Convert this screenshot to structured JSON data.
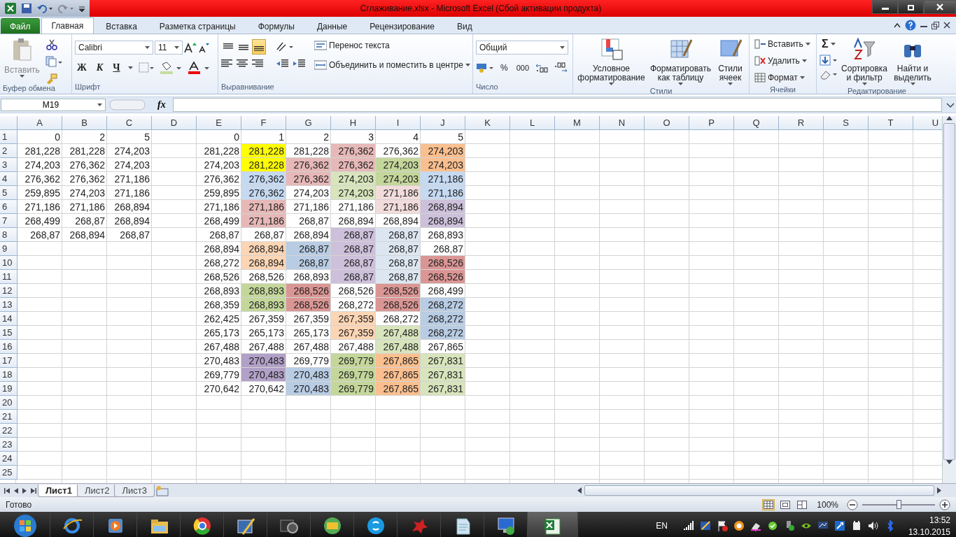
{
  "window": {
    "title": "Сглаживание.xlsx  -  Microsoft Excel (Сбой активации продукта)"
  },
  "tabs": [
    {
      "label": "Файл",
      "kind": "file",
      "selected": false
    },
    {
      "label": "Главная",
      "kind": "tab",
      "selected": true
    },
    {
      "label": "Вставка",
      "kind": "tab",
      "selected": false
    },
    {
      "label": "Разметка страницы",
      "kind": "tab",
      "selected": false
    },
    {
      "label": "Формулы",
      "kind": "tab",
      "selected": false
    },
    {
      "label": "Данные",
      "kind": "tab",
      "selected": false
    },
    {
      "label": "Рецензирование",
      "kind": "tab",
      "selected": false
    },
    {
      "label": "Вид",
      "kind": "tab",
      "selected": false
    }
  ],
  "ribbon": {
    "clipboard": {
      "label": "Буфер обмена",
      "paste": "Вставить"
    },
    "font": {
      "label": "Шрифт",
      "family": "Calibri",
      "size": "11",
      "bold": "Ж",
      "italic": "К",
      "underline": "Ч"
    },
    "alignment": {
      "label": "Выравнивание",
      "wrap": "Перенос текста",
      "merge": "Объединить и поместить в центре",
      "vertical": [
        {
          "selected": false
        },
        {
          "selected": false
        },
        {
          "selected": true
        }
      ]
    },
    "number": {
      "label": "Число",
      "format": "Общий",
      "percent": "%",
      "thousands": "000"
    },
    "styles": {
      "label": "Стили",
      "buttons": [
        "Условное форматирование",
        "Форматировать как таблицу",
        "Стили ячеек"
      ]
    },
    "cells": {
      "label": "Ячейки",
      "buttons": [
        "Вставить",
        "Удалить",
        "Формат"
      ]
    },
    "editing": {
      "label": "Редактирование",
      "sum": "Σ",
      "buttons": [
        "Сортировка и фильтр",
        "Найти и выделить"
      ]
    }
  },
  "formula_bar": {
    "name_box": "M19",
    "fx": "fx"
  },
  "sheet": {
    "columns": [
      "A",
      "B",
      "C",
      "D",
      "E",
      "F",
      "G",
      "H",
      "I",
      "J",
      "K",
      "L",
      "M",
      "N",
      "O",
      "P",
      "Q",
      "R",
      "S",
      "T",
      "U"
    ],
    "rows": [
      {
        "number": "1",
        "cells": [
          "0",
          "2",
          "5",
          null,
          "0",
          "1",
          "2",
          "3",
          "4",
          "5"
        ]
      },
      {
        "number": "2",
        "cells": [
          "281,228",
          "281,228",
          "274,203",
          null,
          "281,228",
          {
            "text": "281,228",
            "color": "#ffff00"
          },
          "281,228",
          {
            "text": "276,362",
            "color": "#e6b8b7"
          },
          "276,362",
          {
            "text": "274,203",
            "color": "#fabf8f"
          }
        ]
      },
      {
        "number": "3",
        "cells": [
          "274,203",
          "276,362",
          "274,203",
          null,
          "274,203",
          {
            "text": "281,228",
            "color": "#ffff00"
          },
          {
            "text": "276,362",
            "color": "#e6b8b7"
          },
          {
            "text": "276,362",
            "color": "#e6b8b7"
          },
          {
            "text": "274,203",
            "color": "#c4d79b"
          },
          {
            "text": "274,203",
            "color": "#fabf8f"
          }
        ]
      },
      {
        "number": "4",
        "cells": [
          "276,362",
          "276,362",
          "271,186",
          null,
          "276,362",
          {
            "text": "276,362",
            "color": "#c5d9f1"
          },
          {
            "text": "276,362",
            "color": "#e6b8b7"
          },
          {
            "text": "274,203",
            "color": "#d8e4bc"
          },
          {
            "text": "274,203",
            "color": "#c4d79b"
          },
          {
            "text": "271,186",
            "color": "#c5d9f1"
          }
        ]
      },
      {
        "number": "5",
        "cells": [
          "259,895",
          "274,203",
          "271,186",
          null,
          "259,895",
          {
            "text": "276,362",
            "color": "#c5d9f1"
          },
          "274,203",
          {
            "text": "274,203",
            "color": "#d8e4bc"
          },
          {
            "text": "271,186",
            "color": "#f2dcdb"
          },
          {
            "text": "271,186",
            "color": "#c5d9f1"
          }
        ]
      },
      {
        "number": "6",
        "cells": [
          "271,186",
          "271,186",
          "268,894",
          null,
          "271,186",
          {
            "text": "271,186",
            "color": "#e6b8b7"
          },
          "271,186",
          "271,186",
          {
            "text": "271,186",
            "color": "#f2dcdb"
          },
          {
            "text": "268,894",
            "color": "#ccc0da"
          }
        ]
      },
      {
        "number": "7",
        "cells": [
          "268,499",
          "268,87",
          "268,894",
          null,
          "268,499",
          {
            "text": "271,186",
            "color": "#e6b8b7"
          },
          "268,87",
          "268,894",
          "268,894",
          {
            "text": "268,894",
            "color": "#ccc0da"
          }
        ]
      },
      {
        "number": "8",
        "cells": [
          "268,87",
          "268,894",
          "268,87",
          null,
          "268,87",
          "268,87",
          "268,894",
          {
            "text": "268,87",
            "color": "#ccc0da"
          },
          {
            "text": "268,87",
            "color": "#dce6f1"
          },
          "268,893"
        ]
      },
      {
        "number": "9",
        "cells": [
          null,
          null,
          null,
          null,
          "268,894",
          {
            "text": "268,894",
            "color": "#fcd5b4"
          },
          {
            "text": "268,87",
            "color": "#b8cce4"
          },
          {
            "text": "268,87",
            "color": "#ccc0da"
          },
          {
            "text": "268,87",
            "color": "#dce6f1"
          },
          "268,87"
        ]
      },
      {
        "number": "10",
        "cells": [
          null,
          null,
          null,
          null,
          "268,272",
          {
            "text": "268,894",
            "color": "#fcd5b4"
          },
          {
            "text": "268,87",
            "color": "#b8cce4"
          },
          {
            "text": "268,87",
            "color": "#ccc0da"
          },
          {
            "text": "268,87",
            "color": "#dce6f1"
          },
          {
            "text": "268,526",
            "color": "#da9694"
          }
        ]
      },
      {
        "number": "11",
        "cells": [
          null,
          null,
          null,
          null,
          "268,526",
          "268,526",
          "268,893",
          {
            "text": "268,87",
            "color": "#ccc0da"
          },
          {
            "text": "268,87",
            "color": "#dce6f1"
          },
          {
            "text": "268,526",
            "color": "#da9694"
          }
        ]
      },
      {
        "number": "12",
        "cells": [
          null,
          null,
          null,
          null,
          "268,893",
          {
            "text": "268,893",
            "color": "#c4d79b"
          },
          {
            "text": "268,526",
            "color": "#da9694"
          },
          "268,526",
          {
            "text": "268,526",
            "color": "#da9694"
          },
          "268,499"
        ]
      },
      {
        "number": "13",
        "cells": [
          null,
          null,
          null,
          null,
          "268,359",
          {
            "text": "268,893",
            "color": "#c4d79b"
          },
          {
            "text": "268,526",
            "color": "#da9694"
          },
          "268,272",
          {
            "text": "268,526",
            "color": "#da9694"
          },
          {
            "text": "268,272",
            "color": "#b8cce4"
          }
        ]
      },
      {
        "number": "14",
        "cells": [
          null,
          null,
          null,
          null,
          "262,425",
          "267,359",
          "267,359",
          {
            "text": "267,359",
            "color": "#fcd5b4"
          },
          "268,272",
          {
            "text": "268,272",
            "color": "#b8cce4"
          }
        ]
      },
      {
        "number": "15",
        "cells": [
          null,
          null,
          null,
          null,
          "265,173",
          "265,173",
          "265,173",
          {
            "text": "267,359",
            "color": "#fcd5b4"
          },
          {
            "text": "267,488",
            "color": "#d8e4bc"
          },
          {
            "text": "268,272",
            "color": "#b8cce4"
          }
        ]
      },
      {
        "number": "16",
        "cells": [
          null,
          null,
          null,
          null,
          "267,488",
          "267,488",
          "267,488",
          "267,488",
          {
            "text": "267,488",
            "color": "#d8e4bc"
          },
          "267,865"
        ]
      },
      {
        "number": "17",
        "cells": [
          null,
          null,
          null,
          null,
          "270,483",
          {
            "text": "270,483",
            "color": "#b1a0c7"
          },
          "269,779",
          {
            "text": "269,779",
            "color": "#c4d79b"
          },
          {
            "text": "267,865",
            "color": "#fabf8f"
          },
          {
            "text": "267,831",
            "color": "#d8e4bc"
          }
        ]
      },
      {
        "number": "18",
        "cells": [
          null,
          null,
          null,
          null,
          "269,779",
          {
            "text": "270,483",
            "color": "#b1a0c7"
          },
          {
            "text": "270,483",
            "color": "#b8cce4"
          },
          {
            "text": "269,779",
            "color": "#c4d79b"
          },
          {
            "text": "267,865",
            "color": "#fabf8f"
          },
          {
            "text": "267,831",
            "color": "#d8e4bc"
          }
        ]
      },
      {
        "number": "19",
        "cells": [
          null,
          null,
          null,
          null,
          "270,642",
          "270,642",
          {
            "text": "270,483",
            "color": "#b8cce4"
          },
          {
            "text": "269,779",
            "color": "#c4d79b"
          },
          {
            "text": "267,865",
            "color": "#fabf8f"
          },
          {
            "text": "267,831",
            "color": "#d8e4bc"
          }
        ]
      },
      {
        "number": "20"
      },
      {
        "number": "21"
      },
      {
        "number": "22"
      },
      {
        "number": "23"
      },
      {
        "number": "24"
      },
      {
        "number": "25"
      }
    ]
  },
  "sheet_tabs": [
    {
      "label": "Лист1",
      "selected": true
    },
    {
      "label": "Лист2",
      "selected": false
    },
    {
      "label": "Лист3",
      "selected": false
    }
  ],
  "status_bar": {
    "text": "Готово",
    "zoom": "100%",
    "zoom_slider": {
      "level": 0.5
    }
  },
  "taskbar": {
    "language": "EN",
    "time": "13:52",
    "date": "13.10.2015"
  }
}
